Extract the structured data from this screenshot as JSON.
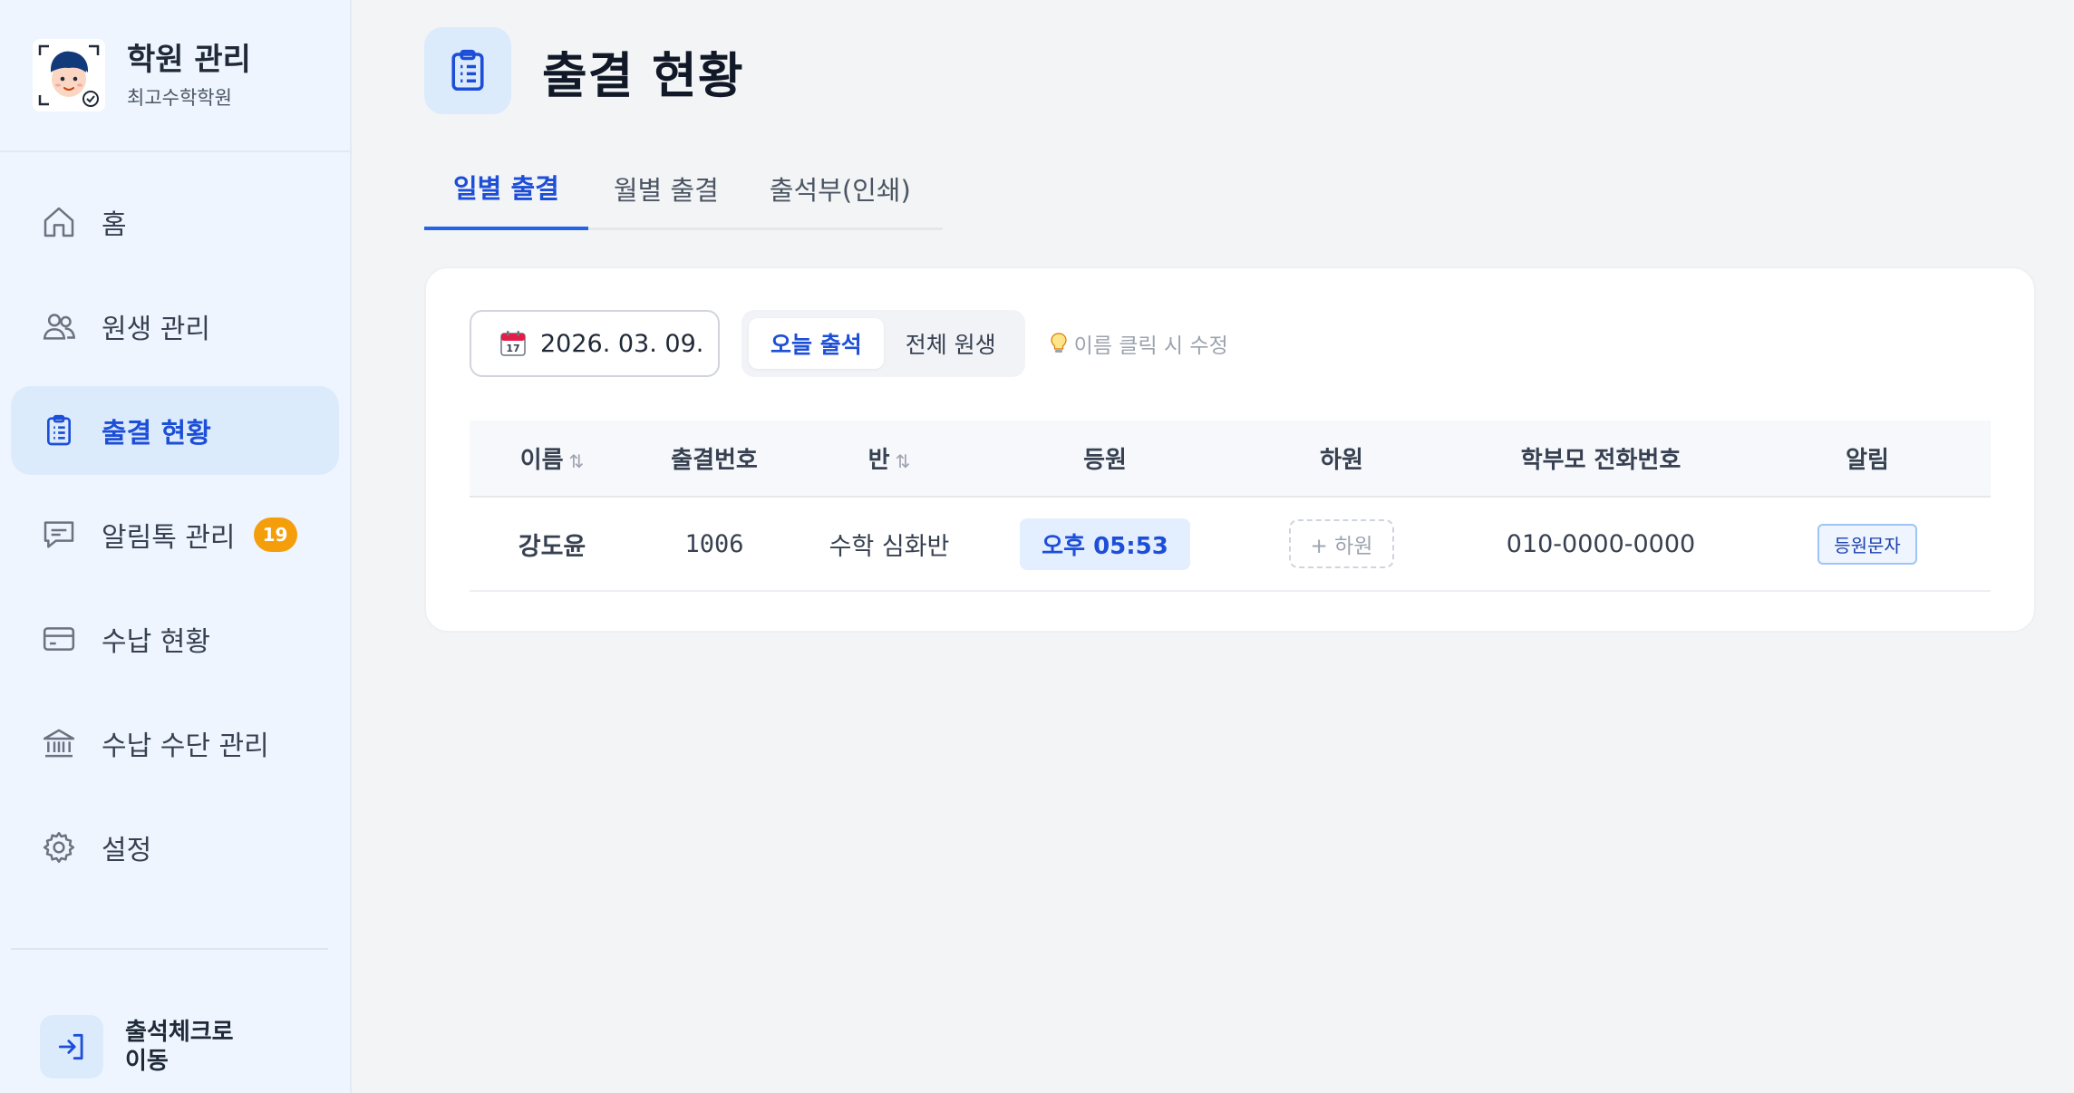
{
  "brand": {
    "title": "학원 관리",
    "subtitle": "최고수학학원"
  },
  "sidebar": {
    "items": [
      {
        "label": "홈",
        "icon": "home-icon"
      },
      {
        "label": "원생 관리",
        "icon": "users-icon"
      },
      {
        "label": "출결 현황",
        "icon": "clipboard-icon",
        "active": true
      },
      {
        "label": "알림톡 관리",
        "icon": "chat-icon",
        "badge": "19"
      },
      {
        "label": "수납 현황",
        "icon": "credit-card-icon"
      },
      {
        "label": "수납 수단 관리",
        "icon": "bank-icon"
      },
      {
        "label": "설정",
        "icon": "gear-icon"
      }
    ],
    "checkout_label": "출석체크로 이동"
  },
  "page": {
    "title": "출결 현황"
  },
  "tabs": [
    "일별 출결",
    "월별 출결",
    "출석부(인쇄)"
  ],
  "toolbar": {
    "date": "2026. 03. 09.",
    "segments": [
      "오늘 출석",
      "전체 원생"
    ],
    "hint": "이름 클릭 시 수정"
  },
  "table": {
    "headers": [
      "이름",
      "출결번호",
      "반",
      "등원",
      "하원",
      "학부모 전화번호",
      "알림"
    ],
    "sort_glyph": "⇅",
    "rows": [
      {
        "name": "강도윤",
        "number": "1006",
        "class": "수학 심화반",
        "checkin": "오후 05:53",
        "checkout": "+ 하원",
        "phone": "010-0000-0000",
        "notify": "등원문자"
      }
    ]
  },
  "colors": {
    "accent": "#2563eb",
    "sidebar_bg": "#eef5ff",
    "badge": "#f59e0b",
    "page_bg": "#f3f4f6"
  }
}
